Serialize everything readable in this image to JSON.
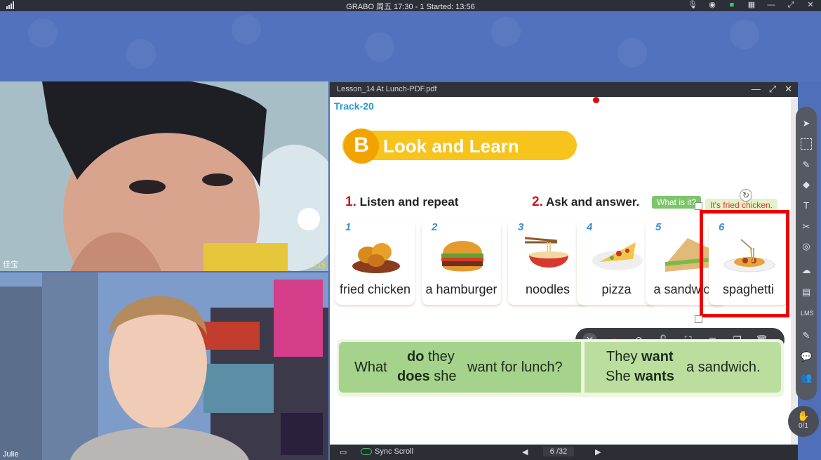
{
  "topbar": {
    "title": "GRABO 周五 17:30 - 1   Started: 13:56",
    "icons": [
      "signal-icon",
      "mic-icon",
      "camera-icon",
      "chat-icon",
      "grid-icon",
      "minimize-icon",
      "maximize-icon",
      "close-icon"
    ]
  },
  "videos": {
    "student": {
      "name": "佳宝",
      "badge": "x15"
    },
    "teacher": {
      "name": "Julie"
    }
  },
  "pdf": {
    "title": "Lesson_14 At Lunch-PDF.pdf",
    "track": "Track-20",
    "banner_letter": "B",
    "banner_text": "Look and Learn",
    "sec1_num": "1.",
    "sec1_text": "Listen and repeat",
    "sec2_num": "2.",
    "sec2_text": "Ask and answer.",
    "chip_question": "What is it?",
    "chip_answer": "It's fried chicken.",
    "items": [
      {
        "num": "1",
        "label": "fried chicken"
      },
      {
        "num": "2",
        "label": "a hamburger"
      },
      {
        "num": "3",
        "label": "noodles"
      },
      {
        "num": "4",
        "label": "pizza"
      },
      {
        "num": "5",
        "label": "a sandwich"
      },
      {
        "num": "6",
        "label": "spaghetti"
      }
    ],
    "sentence": {
      "what": "What",
      "do": "do",
      "they1": "they",
      "does": "does",
      "she1": "she",
      "want_lunch": "want for lunch?",
      "they2": "They",
      "want": "want",
      "she2": "She",
      "wants": "wants",
      "a_sandwich": "a sandwich."
    },
    "footer": {
      "sync": "Sync Scroll",
      "page_current": "6",
      "page_total": "/32"
    }
  },
  "counter": "0/1"
}
